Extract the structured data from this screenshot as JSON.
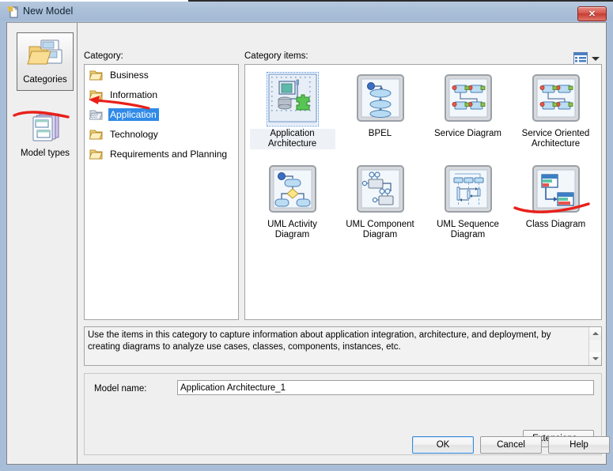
{
  "window": {
    "title": "New Model",
    "title_icon": "new-model-icon",
    "close_label": "✕"
  },
  "sidebar": {
    "items": [
      {
        "label": "Categories",
        "icon": "folder-pages-icon",
        "selected": true
      },
      {
        "label": "Model types",
        "icon": "stacked-pages-icon",
        "selected": false
      }
    ]
  },
  "labels": {
    "category": "Category:",
    "category_items": "Category items:"
  },
  "view_toolbar": {
    "icon": "view-mode-icon",
    "chevron": "chevron-down-icon"
  },
  "categories": [
    {
      "label": "Business",
      "icon": "folder-icon",
      "selected": false
    },
    {
      "label": "Information",
      "icon": "folder-icon",
      "selected": false
    },
    {
      "label": "Application",
      "icon": "folder-app-icon",
      "selected": true
    },
    {
      "label": "Technology",
      "icon": "folder-icon",
      "selected": false
    },
    {
      "label": "Requirements and Planning",
      "icon": "folder-icon",
      "selected": false
    }
  ],
  "category_items": [
    {
      "label": "Application Architecture",
      "icon": "application-architecture-icon",
      "selected": true
    },
    {
      "label": "BPEL",
      "icon": "bpel-icon",
      "selected": false
    },
    {
      "label": "Service Diagram",
      "icon": "service-diagram-icon",
      "selected": false
    },
    {
      "label": "Service Oriented Architecture",
      "icon": "service-oriented-architecture-icon",
      "selected": false
    },
    {
      "label": "UML Activity Diagram",
      "icon": "uml-activity-diagram-icon",
      "selected": false
    },
    {
      "label": "UML Component Diagram",
      "icon": "uml-component-diagram-icon",
      "selected": false
    },
    {
      "label": "UML Sequence Diagram",
      "icon": "uml-sequence-diagram-icon",
      "selected": false
    },
    {
      "label": "Class Diagram",
      "icon": "class-diagram-icon",
      "selected": false
    }
  ],
  "description": {
    "text": "Use the items in this category to capture information about application integration, architecture, and deployment, by creating diagrams to analyze use cases, classes, components, instances, etc."
  },
  "model_name": {
    "label": "Model name:",
    "value": "Application Architecture_1",
    "placeholder": ""
  },
  "buttons": {
    "extensions": "Extensions...",
    "ok": "OK",
    "cancel": "Cancel",
    "help": "Help"
  },
  "colors": {
    "selection_blue": "#2f8ae8",
    "annotation_red": "#e8201a",
    "titlebar": "#aabfd8",
    "dialog_bg": "#efefef"
  }
}
